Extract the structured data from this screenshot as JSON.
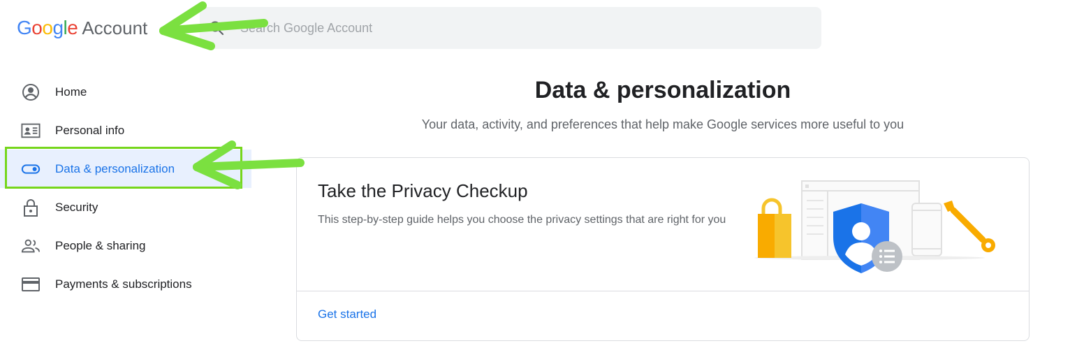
{
  "header": {
    "logo_letters": [
      {
        "ch": "G",
        "color": "#4285F4"
      },
      {
        "ch": "o",
        "color": "#EA4335"
      },
      {
        "ch": "o",
        "color": "#FBBC05"
      },
      {
        "ch": "g",
        "color": "#4285F4"
      },
      {
        "ch": "l",
        "color": "#34A853"
      },
      {
        "ch": "e",
        "color": "#EA4335"
      }
    ],
    "product": "Account",
    "search_placeholder": "Search Google Account",
    "search_icon": "search-icon"
  },
  "sidebar": {
    "items": [
      {
        "label": "Home",
        "icon": "home-account-icon"
      },
      {
        "label": "Personal info",
        "icon": "id-card-icon"
      },
      {
        "label": "Data & personalization",
        "icon": "toggle-icon",
        "active": true
      },
      {
        "label": "Security",
        "icon": "lock-icon"
      },
      {
        "label": "People & sharing",
        "icon": "people-icon"
      },
      {
        "label": "Payments & subscriptions",
        "icon": "credit-card-icon"
      }
    ]
  },
  "main": {
    "title": "Data & personalization",
    "subtitle": "Your data, activity, and preferences that help make Google services more useful to you",
    "card": {
      "title": "Take the Privacy Checkup",
      "description": "This step-by-step guide helps you choose the privacy settings that are right for you",
      "link": "Get started"
    }
  },
  "colors": {
    "accent": "#1a73e8",
    "active_bg": "#e8f0fe",
    "annotation": "#76d61c"
  }
}
